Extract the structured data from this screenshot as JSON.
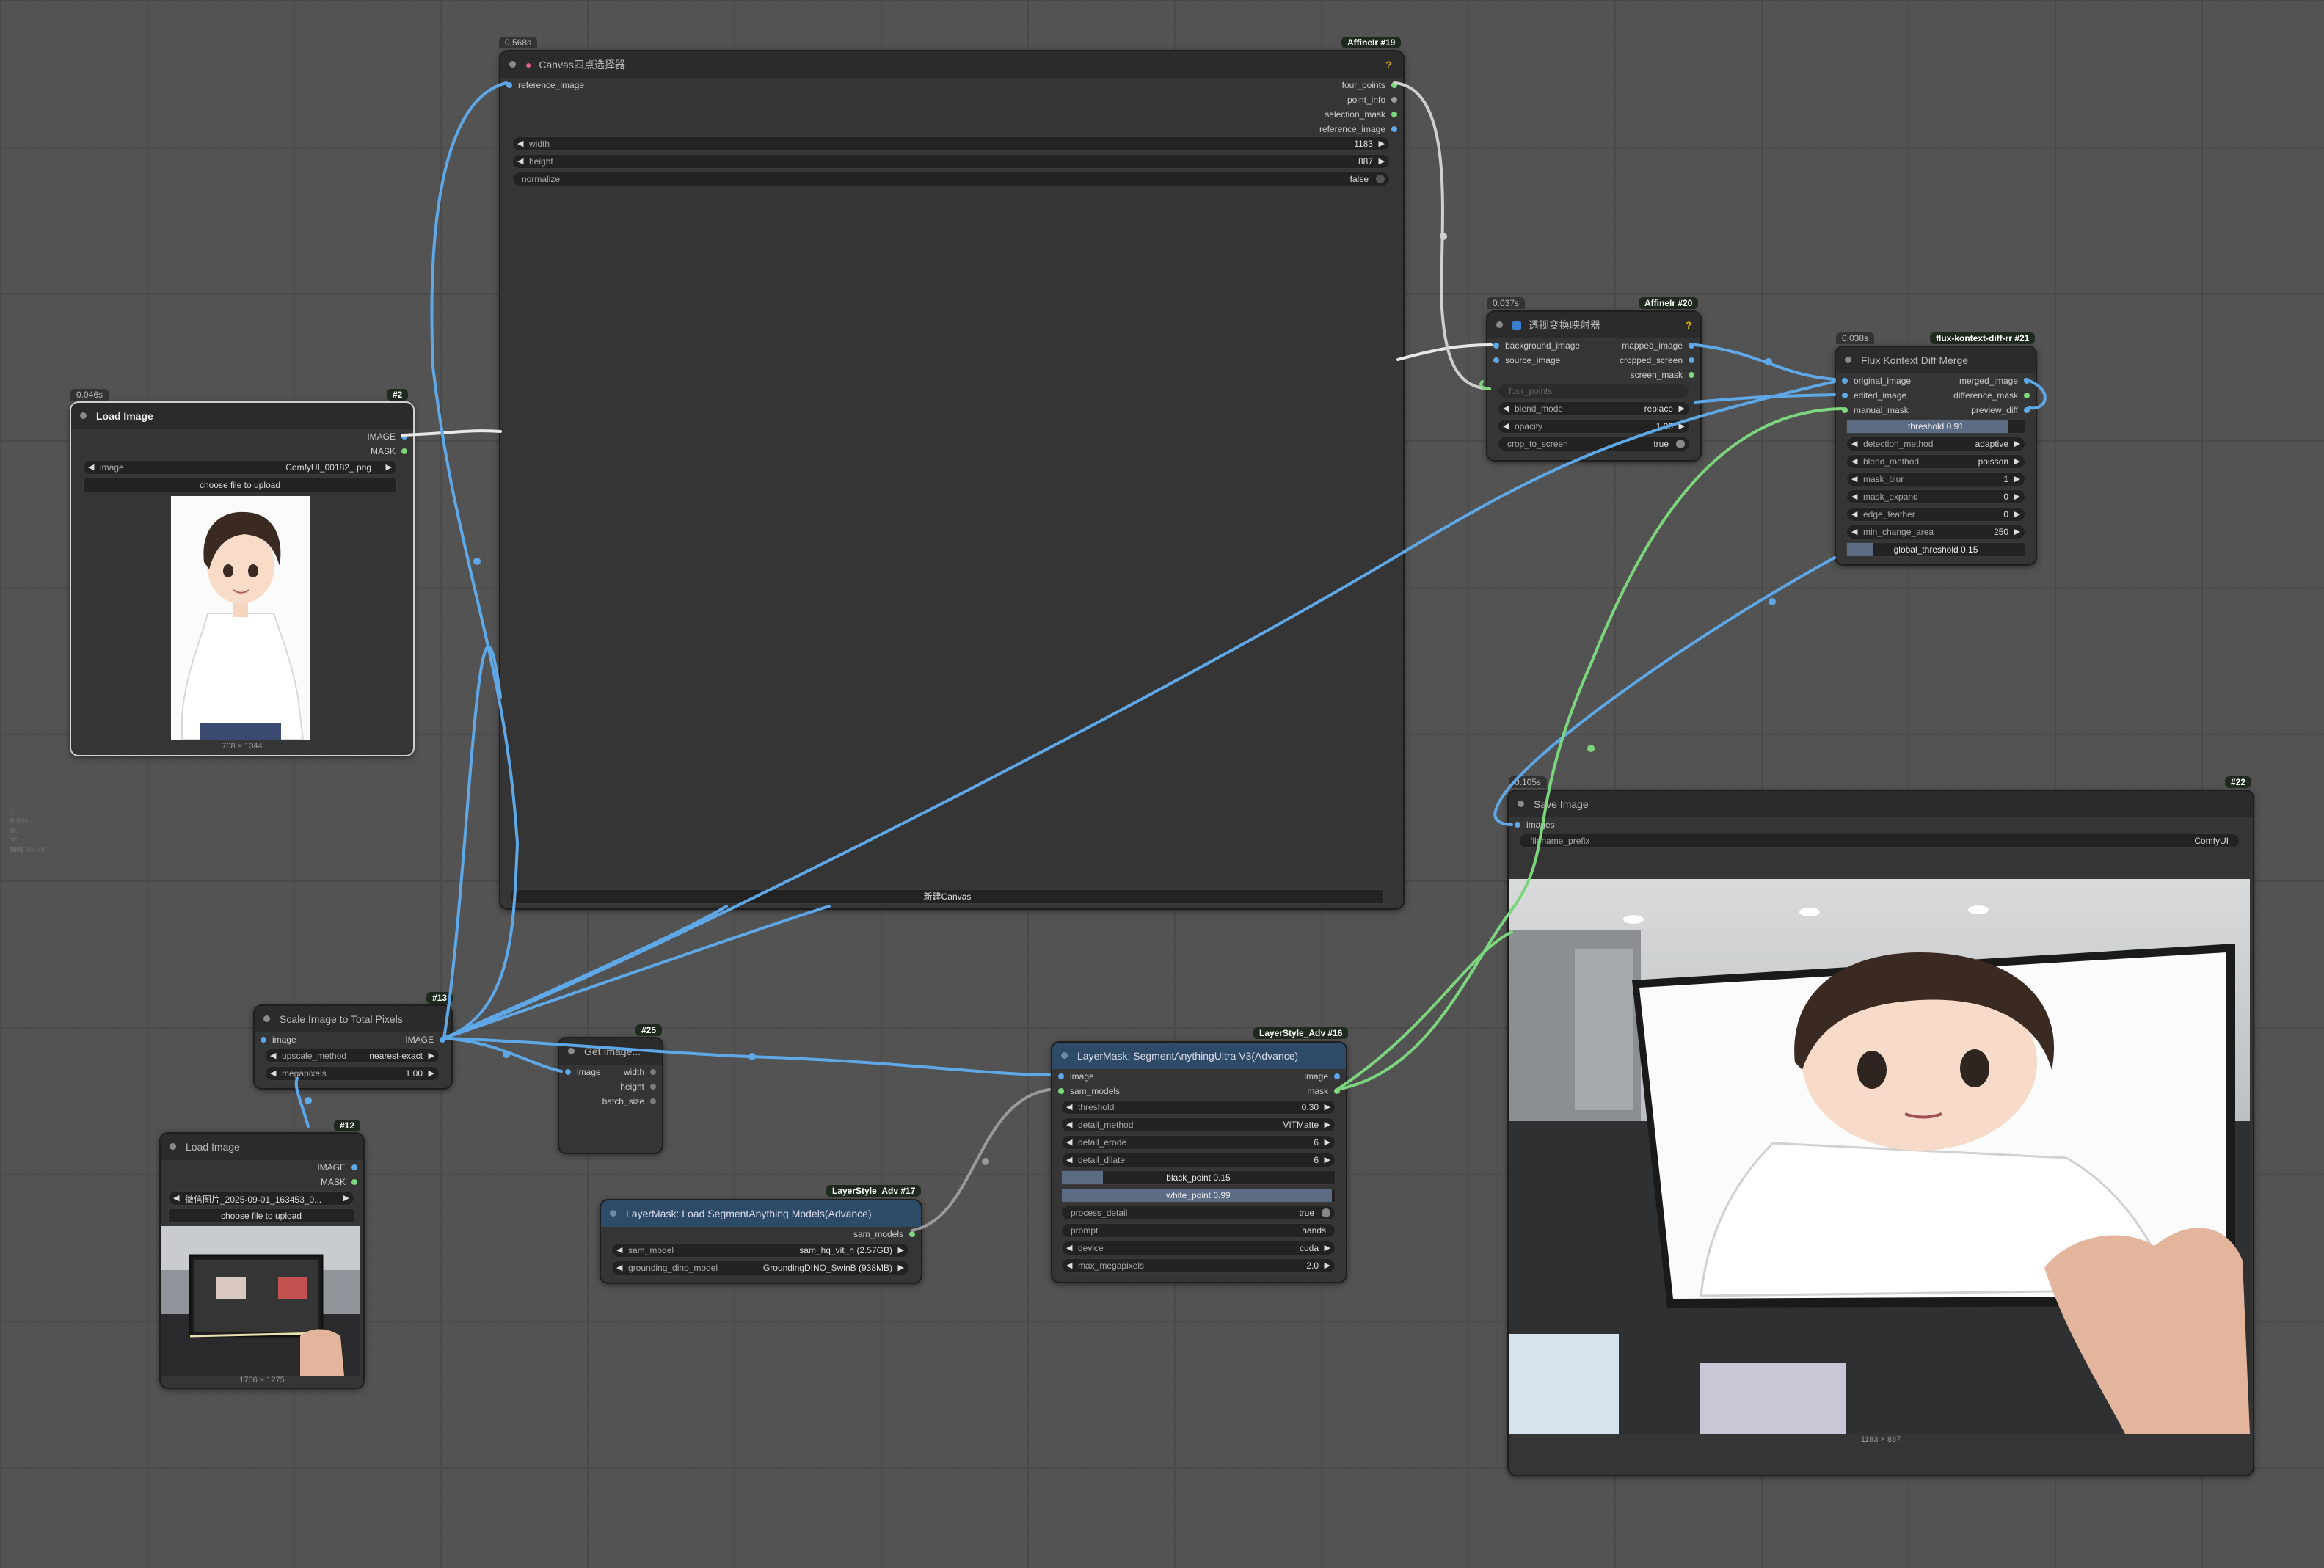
{
  "stats": [
    "T: 0.00s",
    "I: 0",
    "N: 10 [10]",
    "V: 49",
    "FPS:48.78"
  ],
  "canvas_node": {
    "timing": "0.568s",
    "badge": "AffineIr #19",
    "title": "Canvas四点选择器",
    "input": "reference_image",
    "outputs": [
      "four_points",
      "point_info",
      "selection_mask",
      "reference_image"
    ],
    "width_label": "width",
    "width_value": "1183",
    "height_label": "height",
    "height_value": "887",
    "normalize_label": "normalize",
    "normalize_value": "false",
    "button": "新建Canvas"
  },
  "load_image_1": {
    "timing": "0.046s",
    "badge": "#2",
    "title": "Load Image",
    "outputs": [
      "IMAGE",
      "MASK"
    ],
    "image_label": "image",
    "image_value": "ComfyUI_00182_.png",
    "upload_button": "choose file to upload",
    "preview_caption": "768 × 1344"
  },
  "scale_node": {
    "badge": "#13",
    "title": "Scale Image to Total Pixels",
    "input": "image",
    "output": "IMAGE",
    "upscale_label": "upscale_method",
    "upscale_value": "nearest-exact",
    "megapixels_label": "megapixels",
    "megapixels_value": "1.00"
  },
  "load_image_2": {
    "badge": "#12",
    "title": "Load Image",
    "outputs": [
      "IMAGE",
      "MASK"
    ],
    "image_value": "微信图片_2025-09-01_163453_0...",
    "upload_button": "choose file to upload",
    "preview_caption": "1706 × 1275"
  },
  "get_image_node": {
    "badge": "#25",
    "title": "Get Image...",
    "input": "image",
    "outputs": [
      "width",
      "height",
      "batch_size"
    ]
  },
  "sam_loader": {
    "badge": "LayerStyle_Adv #17",
    "title": "LayerMask: Load SegmentAnything Models(Advance)",
    "output": "sam_models",
    "sam_label": "sam_model",
    "sam_value": "sam_hq_vit_h (2.57GB)",
    "dino_label": "grounding_dino_model",
    "dino_value": "GroundingDINO_SwinB (938MB)"
  },
  "sam_ultra": {
    "badge": "LayerStyle_Adv #16",
    "title": "LayerMask: SegmentAnythingUltra V3(Advance)",
    "inputs": [
      "image",
      "sam_models"
    ],
    "outputs": [
      "image",
      "mask"
    ],
    "widgets": [
      {
        "label": "threshold",
        "value": "0.30"
      },
      {
        "label": "detail_method",
        "value": "VITMatte"
      },
      {
        "label": "detail_erode",
        "value": "6"
      },
      {
        "label": "detail_dilate",
        "value": "6"
      }
    ],
    "black_point": "black_point  0.15",
    "black_point_fill": 0.15,
    "white_point": "white_point  0.99",
    "white_point_fill": 0.99,
    "process_detail_label": "process_detail",
    "process_detail_value": "true",
    "prompt_label": "prompt",
    "prompt_value": "hands",
    "device_label": "device",
    "device_value": "cuda",
    "max_mp_label": "max_megapixels",
    "max_mp_value": "2.0"
  },
  "perspective_node": {
    "timing": "0.037s",
    "badge": "AffineIr #20",
    "title": "透视变换映射器",
    "inputs": [
      "background_image",
      "source_image"
    ],
    "outputs": [
      "mapped_image",
      "cropped_screen",
      "screen_mask"
    ],
    "four_points": "four_points",
    "blend_label": "blend_mode",
    "blend_value": "replace",
    "opacity_label": "opacity",
    "opacity_value": "1.00",
    "crop_label": "crop_to_screen",
    "crop_value": "true"
  },
  "diff_merge": {
    "timing": "0.038s",
    "badge": "flux-kontext-diff-rr #21",
    "title": "Flux Kontext Diff Merge",
    "inputs": [
      "original_image",
      "edited_image",
      "manual_mask"
    ],
    "outputs": [
      "merged_image",
      "difference_mask",
      "preview_diff"
    ],
    "threshold_text": "threshold  0.91",
    "threshold_fill": 0.91,
    "widgets": [
      {
        "label": "detection_method",
        "value": "adaptive"
      },
      {
        "label": "blend_method",
        "value": "poisson"
      },
      {
        "label": "mask_blur",
        "value": "1"
      },
      {
        "label": "mask_expand",
        "value": "0"
      },
      {
        "label": "edge_feather",
        "value": "0"
      },
      {
        "label": "min_change_area",
        "value": "250"
      }
    ],
    "global_threshold_text": "global_threshold  0.15",
    "global_threshold_fill": 0.15
  },
  "save_image": {
    "timing": "0.105s",
    "badge": "#22",
    "title": "Save Image",
    "input": "images",
    "prefix_label": "filename_prefix",
    "prefix_value": "ComfyUI",
    "preview_caption": "1183 × 887"
  },
  "colors": {
    "image_link": "#5fa8e8",
    "mask_link": "#7dd67d",
    "sam_link": "#9a9a9a",
    "background": "#535353"
  }
}
